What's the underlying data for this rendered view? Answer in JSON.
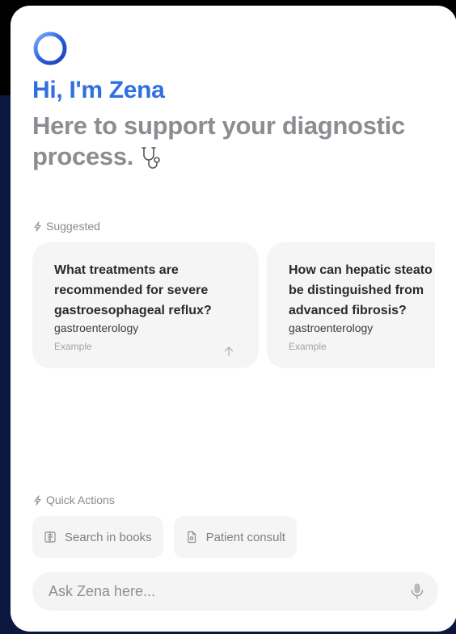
{
  "header": {
    "logo_icon": "ring-logo-icon",
    "greeting": "Hi, I'm Zena",
    "tagline": "Here to support your diagnostic process.",
    "tagline_icon": "stethoscope-icon"
  },
  "suggested": {
    "label": "Suggested",
    "label_icon": "lightning-icon",
    "cards": [
      {
        "question_lines": [
          "What treatments are",
          "recommended for severe",
          "gastroesophageal reflux?"
        ],
        "tag": "gastroenterology",
        "example_label": "Example",
        "action_icon": "arrow-up-icon"
      },
      {
        "question_lines": [
          "How can hepatic steato",
          "be distinguished from",
          "advanced fibrosis?"
        ],
        "tag": "gastroenterology",
        "example_label": "Example"
      }
    ]
  },
  "quick_actions": {
    "label": "Quick Actions",
    "label_icon": "lightning-icon",
    "items": [
      {
        "label": "Search in books",
        "icon": "book-icon"
      },
      {
        "label": "Patient consult",
        "icon": "document-icon"
      }
    ]
  },
  "ask": {
    "placeholder": "Ask Zena here...",
    "icon": "microphone-icon"
  },
  "colors": {
    "accent": "#2f6fe0",
    "muted_text": "#8c8c92",
    "card_bg": "#f5f5f6",
    "backdrop": "#0c1740"
  }
}
